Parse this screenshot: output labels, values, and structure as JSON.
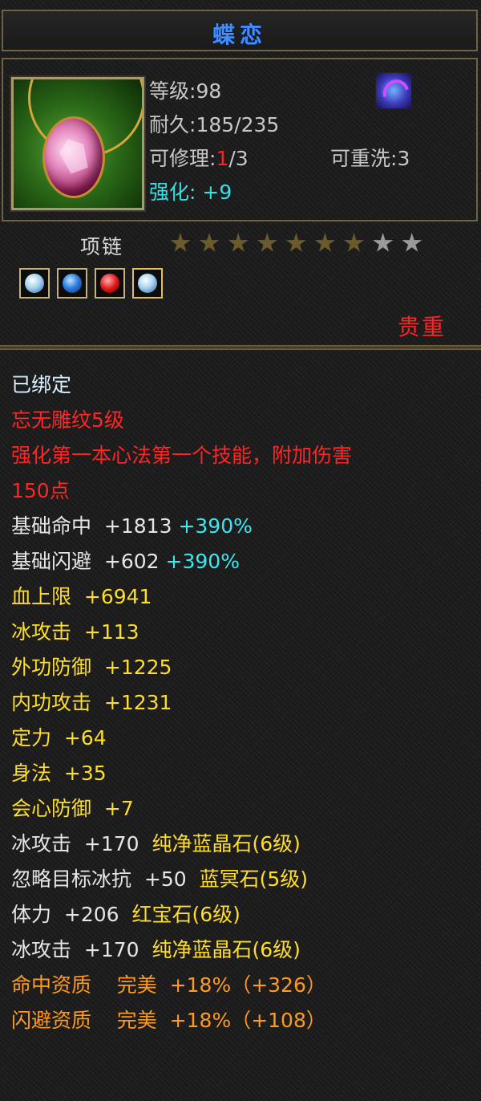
{
  "item": {
    "name": "蝶恋",
    "level_label": "等级",
    "level_value": "98",
    "durability_label": "耐久",
    "durability_value": "185/235",
    "repair_label": "可修理",
    "repair_used": "1",
    "repair_total": "/3",
    "rewash_label": "可重洗",
    "rewash_value": "3",
    "enhance_label": "强化:",
    "enhance_value": "+9",
    "type": "项链",
    "stars_total": 9,
    "stars_filled": 7,
    "rarity": "贵重",
    "icon": "pink-gem-necklace-icon",
    "skill_icon": "purple-swirl-skill-icon"
  },
  "gems": [
    {
      "name": "pale-blue-crystal-gem-icon"
    },
    {
      "name": "blue-crystal-gem-icon"
    },
    {
      "name": "ruby-gem-icon"
    },
    {
      "name": "pale-blue-crystal-gem-icon-gold"
    }
  ],
  "attributes": {
    "bound": "已绑定",
    "engrave_line": "忘无雕纹5级",
    "skill_bonus_line1": "强化第一本心法第一个技能，附加伤害",
    "skill_bonus_line2": "150点",
    "hit_label": "基础命中",
    "hit_value": "+1813",
    "hit_pct": "+390%",
    "dodge_label": "基础闪避",
    "dodge_value": "+602",
    "dodge_pct": "+390%",
    "hp": "血上限  +6941",
    "ice_atk": "冰攻击  +113",
    "ext_def": "外功防御  +1225",
    "int_atk": "内功攻击  +1231",
    "focus": "定力  +64",
    "agility": "身法  +35",
    "crit_def": "会心防御  +7",
    "gem1_stat": "冰攻击  +170",
    "gem1_name": "纯净蓝晶石(6级)",
    "gem2_stat": "忽略目标冰抗  +50",
    "gem2_name": "蓝冥石(5级)",
    "gem3_stat": "体力  +206",
    "gem3_name": "红宝石(6级)",
    "gem4_stat": "冰攻击  +170",
    "gem4_name": "纯净蓝晶石(6级)",
    "aptitude_hit": "命中资质    完美  +18%（+326）",
    "aptitude_dodge": "闪避资质    完美  +18%（+108）"
  },
  "colors": {
    "title": "#3f8dff",
    "bound": "#d8f0ff",
    "special": "#ff2525",
    "base": "#e6e6e6",
    "percent": "#3be8f0",
    "gem": "#ffde2a",
    "aptitude": "#ff9a1f",
    "border": "#6d6248"
  }
}
